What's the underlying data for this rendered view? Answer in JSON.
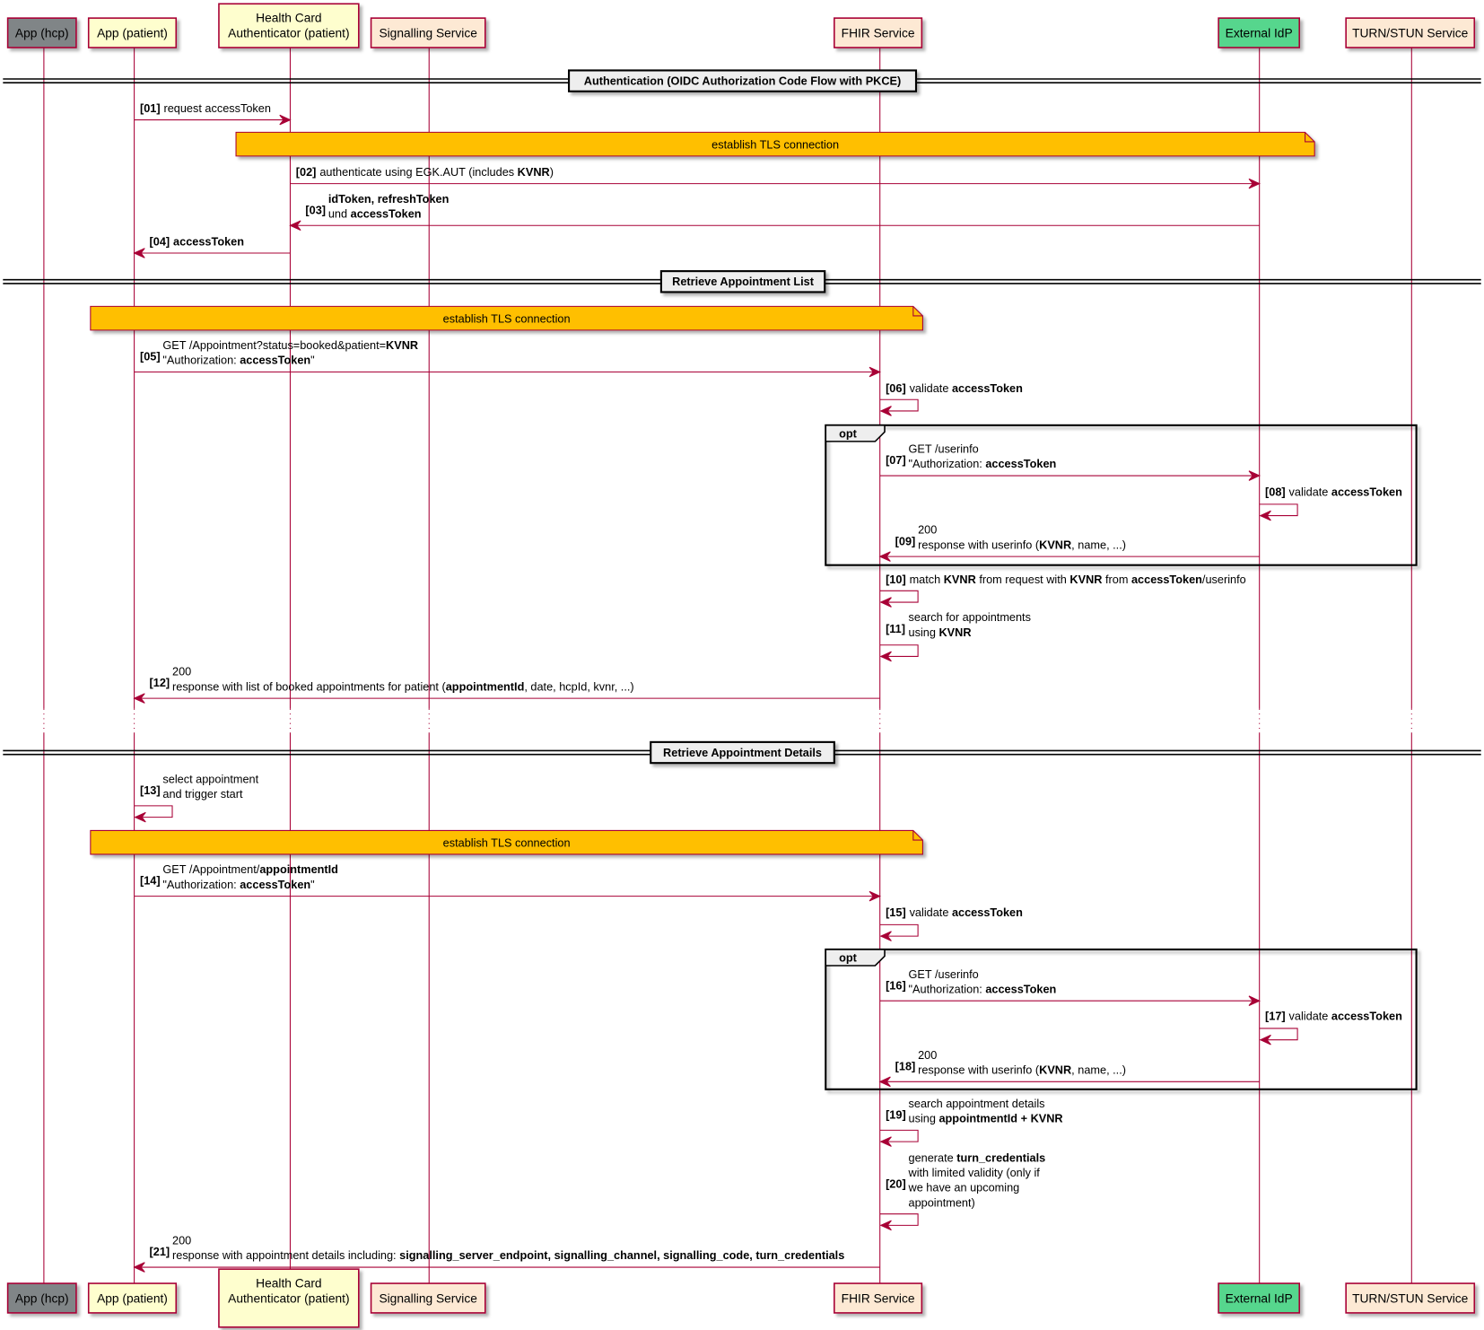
{
  "participants": [
    {
      "id": "hcp",
      "lines": [
        "App (hcp)"
      ],
      "fill": "#808587"
    },
    {
      "id": "patient",
      "lines": [
        "App (patient)"
      ],
      "fill": "#FEFECE"
    },
    {
      "id": "hca",
      "lines": [
        "Health Card",
        "Authenticator (patient)"
      ],
      "fill": "#FEFECE"
    },
    {
      "id": "sig",
      "lines": [
        "Signalling Service"
      ],
      "fill": "#FDE9D4"
    },
    {
      "id": "fhir",
      "lines": [
        "FHIR Service"
      ],
      "fill": "#FDE9D4"
    },
    {
      "id": "idp",
      "lines": [
        "External IdP"
      ],
      "fill": "#57D68D"
    },
    {
      "id": "turn",
      "lines": [
        "TURN/STUN Service"
      ],
      "fill": "#FDE9D4"
    }
  ],
  "colors": {
    "line": "#A80036",
    "note": "#FFBF00",
    "text": "#000000"
  },
  "dividers": [
    "Authentication (OIDC Authorization Code Flow with PKCE)",
    "Retrieve Appointment List",
    "Retrieve Appointment Details"
  ],
  "notes": [
    "establish TLS connection",
    "establish TLS connection",
    "establish TLS connection"
  ],
  "groups": [
    "opt",
    "opt"
  ],
  "messages": [
    {
      "num": "[01]",
      "from": "patient",
      "to": "hca",
      "lines": [
        [
          {
            "t": "request accessToken"
          }
        ]
      ]
    },
    {
      "num": "[02]",
      "from": "hca",
      "to": "idp",
      "lines": [
        [
          {
            "t": "authenticate using EGK.AUT (includes "
          },
          {
            "t": "KVNR",
            "b": true
          },
          {
            "t": ")"
          }
        ]
      ]
    },
    {
      "num": "[03]",
      "from": "idp",
      "to": "hca",
      "lines": [
        [
          {
            "t": "idToken, refreshToken",
            "b": true
          }
        ],
        [
          {
            "t": "und "
          },
          {
            "t": "accessToken",
            "b": true
          }
        ]
      ]
    },
    {
      "num": "[04]",
      "from": "hca",
      "to": "patient",
      "lines": [
        [
          {
            "t": "accessToken",
            "b": true
          }
        ]
      ]
    },
    {
      "num": "[05]",
      "from": "patient",
      "to": "fhir",
      "lines": [
        [
          {
            "t": "GET /Appointment?status=booked&patient="
          },
          {
            "t": "KVNR",
            "b": true
          }
        ],
        [
          {
            "t": "\"Authorization: "
          },
          {
            "t": "accessToken",
            "b": true
          },
          {
            "t": "\""
          }
        ]
      ]
    },
    {
      "num": "[06]",
      "from": "fhir",
      "to": "fhir",
      "lines": [
        [
          {
            "t": "validate "
          },
          {
            "t": "accessToken",
            "b": true
          }
        ]
      ]
    },
    {
      "num": "[07]",
      "from": "fhir",
      "to": "idp",
      "lines": [
        [
          {
            "t": "GET /userinfo"
          }
        ],
        [
          {
            "t": "\"Authorization: "
          },
          {
            "t": "accessToken",
            "b": true
          }
        ]
      ]
    },
    {
      "num": "[08]",
      "from": "idp",
      "to": "idp",
      "lines": [
        [
          {
            "t": "validate "
          },
          {
            "t": "accessToken",
            "b": true
          }
        ]
      ]
    },
    {
      "num": "[09]",
      "from": "idp",
      "to": "fhir",
      "lines": [
        [
          {
            "t": "200"
          }
        ],
        [
          {
            "t": "response with userinfo ("
          },
          {
            "t": "KVNR",
            "b": true
          },
          {
            "t": ", name, ...)"
          }
        ]
      ]
    },
    {
      "num": "[10]",
      "from": "fhir",
      "to": "fhir",
      "lines": [
        [
          {
            "t": "match "
          },
          {
            "t": "KVNR",
            "b": true
          },
          {
            "t": " from request with "
          },
          {
            "t": "KVNR",
            "b": true
          },
          {
            "t": " from "
          },
          {
            "t": "accessToken",
            "b": true
          },
          {
            "t": "/userinfo"
          }
        ]
      ]
    },
    {
      "num": "[11]",
      "from": "fhir",
      "to": "fhir",
      "lines": [
        [
          {
            "t": "search for appointments"
          }
        ],
        [
          {
            "t": "using "
          },
          {
            "t": "KVNR",
            "b": true
          }
        ]
      ]
    },
    {
      "num": "[12]",
      "from": "fhir",
      "to": "patient",
      "lines": [
        [
          {
            "t": "200"
          }
        ],
        [
          {
            "t": "response with list of booked appointments for patient ("
          },
          {
            "t": "appointmentId",
            "b": true
          },
          {
            "t": ", date, hcpId, kvnr, ...)"
          }
        ]
      ]
    },
    {
      "num": "[13]",
      "from": "patient",
      "to": "patient",
      "lines": [
        [
          {
            "t": "select appointment"
          }
        ],
        [
          {
            "t": "and trigger start"
          }
        ]
      ]
    },
    {
      "num": "[14]",
      "from": "patient",
      "to": "fhir",
      "lines": [
        [
          {
            "t": "GET /Appointment/"
          },
          {
            "t": "appointmentId",
            "b": true
          }
        ],
        [
          {
            "t": "\"Authorization: "
          },
          {
            "t": "accessToken",
            "b": true
          },
          {
            "t": "\""
          }
        ]
      ]
    },
    {
      "num": "[15]",
      "from": "fhir",
      "to": "fhir",
      "lines": [
        [
          {
            "t": "validate "
          },
          {
            "t": "accessToken",
            "b": true
          }
        ]
      ]
    },
    {
      "num": "[16]",
      "from": "fhir",
      "to": "idp",
      "lines": [
        [
          {
            "t": "GET /userinfo"
          }
        ],
        [
          {
            "t": "\"Authorization: "
          },
          {
            "t": "accessToken",
            "b": true
          }
        ]
      ]
    },
    {
      "num": "[17]",
      "from": "idp",
      "to": "idp",
      "lines": [
        [
          {
            "t": "validate "
          },
          {
            "t": "accessToken",
            "b": true
          }
        ]
      ]
    },
    {
      "num": "[18]",
      "from": "idp",
      "to": "fhir",
      "lines": [
        [
          {
            "t": "200"
          }
        ],
        [
          {
            "t": "response with userinfo ("
          },
          {
            "t": "KVNR",
            "b": true
          },
          {
            "t": ", name, ...)"
          }
        ]
      ]
    },
    {
      "num": "[19]",
      "from": "fhir",
      "to": "fhir",
      "lines": [
        [
          {
            "t": "search appointment details"
          }
        ],
        [
          {
            "t": "using "
          },
          {
            "t": "appointmentId + KVNR",
            "b": true
          }
        ]
      ]
    },
    {
      "num": "[20]",
      "from": "fhir",
      "to": "fhir",
      "lines": [
        [
          {
            "t": "generate "
          },
          {
            "t": "turn_credentials",
            "b": true
          }
        ],
        [
          {
            "t": "with limited validity (only if"
          }
        ],
        [
          {
            "t": "we have an upcoming"
          }
        ],
        [
          {
            "t": "appointment)"
          }
        ]
      ]
    },
    {
      "num": "[21]",
      "from": "fhir",
      "to": "patient",
      "lines": [
        [
          {
            "t": "200"
          }
        ],
        [
          {
            "t": "response with appointment details including: "
          },
          {
            "t": "signalling_server_endpoint, signalling_channel, signalling_code, turn_credentials",
            "b": true
          }
        ]
      ]
    }
  ]
}
